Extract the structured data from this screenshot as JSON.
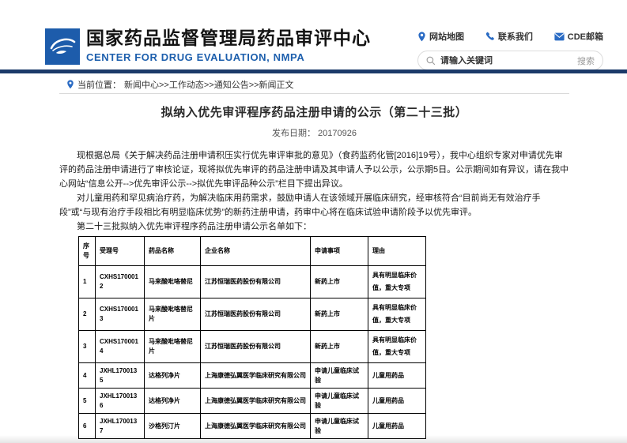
{
  "colors": {
    "brand_blue": "#1d5fad",
    "logo_blue": "#1d5cab",
    "navy_bar": "#1b3a69",
    "table_border": "#000000"
  },
  "header": {
    "site_name_cn": "国家药品监督管理局药品审评中心",
    "site_name_en": "CENTER FOR DRUG EVALUATION, NMPA",
    "links": [
      {
        "icon": "map-pin-icon",
        "label": "网站地图"
      },
      {
        "icon": "phone-icon",
        "label": "联系我们"
      },
      {
        "icon": "mail-icon",
        "label": "CDE邮箱"
      }
    ],
    "search": {
      "placeholder": "请输入关键词",
      "button_label": "搜索"
    }
  },
  "breadcrumb": {
    "label": "当前位置：",
    "path": "新闻中心>>工作动态>>通知公告>>新闻正文"
  },
  "article": {
    "title": "拟纳入优先审评程序药品注册申请的公示（第二十三批）",
    "date_label": "发布日期：",
    "date_value": "20170926",
    "paragraphs": [
      "现根据总局《关于解决药品注册申请积压实行优先审评审批的意见》（食药监药化管[2016]19号），我中心组织专家对申请优先审评的药品注册申请进行了审核论证，现将拟优先审评的药品注册申请及其申请人予以公示，公示期5日。公示期间如有异议，请在我中心网站“信息公开-->优先审评公示-->拟优先审评品种公示”栏目下提出异议。",
      "对儿童用药和罕见病治疗药，为解决临床用药需求，鼓励申请人在该领域开展临床研究，经审核符合“目前尚无有效治疗手段”或“与现有治疗手段相比有明显临床优势”的新药注册申请，药审中心将在临床试验申请阶段予以优先审评。",
      "第二十三批拟纳入优先审评程序药品注册申请公示名单如下："
    ]
  },
  "table": {
    "headers": [
      "序号",
      "受理号",
      "药品名称",
      "企业名称",
      "申请事项",
      "理由"
    ],
    "rows": [
      [
        "1",
        "CXHS1700012",
        "马来酸吡咯替尼",
        "江苏恒瑞医药股份有限公司",
        "新药上市",
        "具有明显临床价值，重大专项"
      ],
      [
        "2",
        "CXHS1700013",
        "马来酸吡咯替尼片",
        "江苏恒瑞医药股份有限公司",
        "新药上市",
        "具有明显临床价值，重大专项"
      ],
      [
        "3",
        "CXHS1700014",
        "马来酸吡咯替尼片",
        "江苏恒瑞医药股份有限公司",
        "新药上市",
        "具有明显临床价值，重大专项"
      ],
      [
        "4",
        "JXHL1700135",
        "达格列净片",
        "上海康德弘翼医学临床研究有限公司",
        "申请儿童临床试验",
        "儿童用药品"
      ],
      [
        "5",
        "JXHL1700136",
        "达格列净片",
        "上海康德弘翼医学临床研究有限公司",
        "申请儿童临床试验",
        "儿童用药品"
      ],
      [
        "6",
        "JXHL1700137",
        "沙格列汀片",
        "上海康德弘翼医学临床研究有限公司",
        "申请儿童临床试验",
        "儿童用药品"
      ]
    ]
  }
}
